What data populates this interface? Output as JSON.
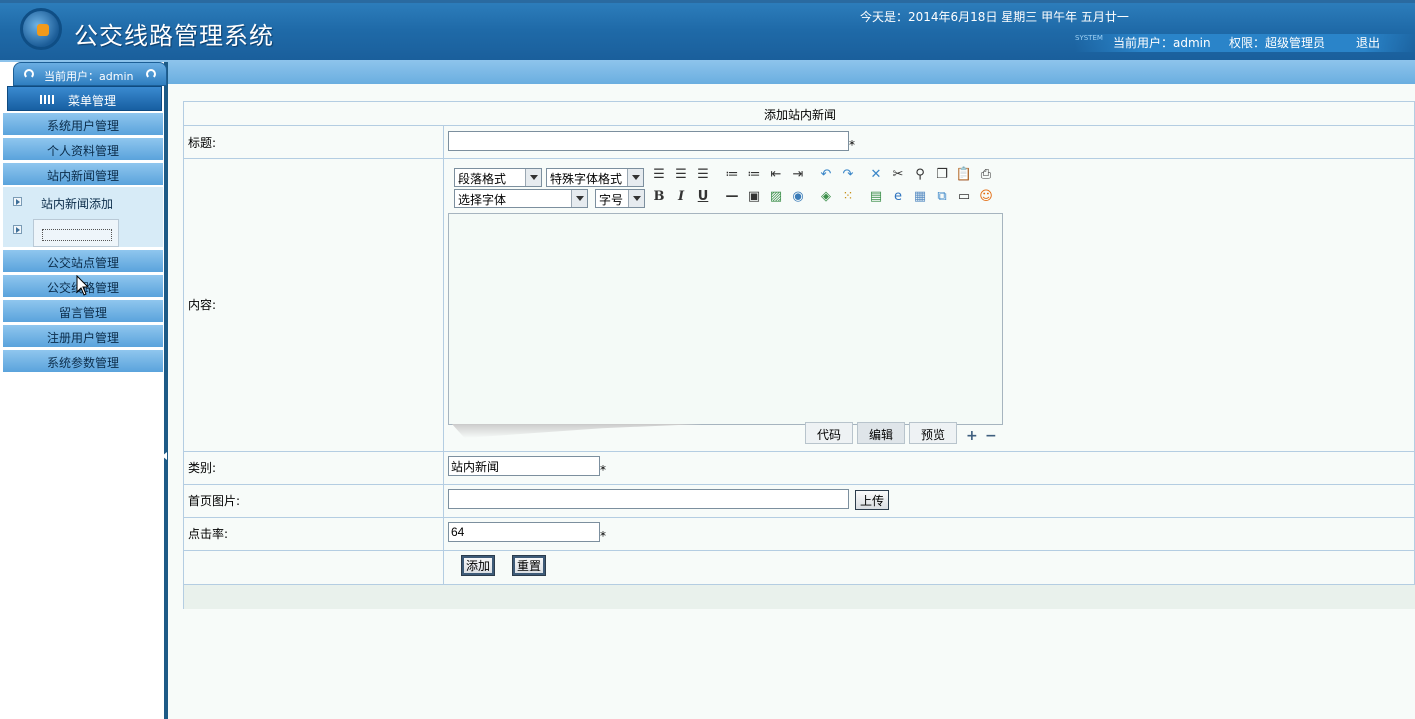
{
  "header": {
    "app_title": "公交线路管理系统",
    "today": "今天是：2014年6月18日 星期三 甲午年 五月廿一",
    "system_tag": "SYSTEM",
    "current_user": "当前用户：admin",
    "permission": "权限：超级管理员",
    "logout": "退出"
  },
  "sidebar": {
    "current_user_tab": "当前用户：admin",
    "menu_header": "菜单管理",
    "items": [
      {
        "label": "系统用户管理"
      },
      {
        "label": "个人资料管理"
      },
      {
        "label": "站内新闻管理"
      },
      {
        "label": "公交站点管理"
      },
      {
        "label": "公交线路管理"
      },
      {
        "label": "留言管理"
      },
      {
        "label": "注册用户管理"
      },
      {
        "label": "系统参数管理"
      }
    ],
    "sub_items": [
      {
        "label": "站内新闻添加"
      },
      {
        "label": ""
      }
    ]
  },
  "form": {
    "heading": "添加站内新闻",
    "title_label": "标题:",
    "title_value": "",
    "required_mark": "*",
    "content_label": "内容:",
    "category_label": "类别:",
    "category_value": "站内新闻",
    "image_label": "首页图片:",
    "image_value": "",
    "upload_button": "上传",
    "clicks_label": "点击率:",
    "clicks_value": "64",
    "add_button": "添加",
    "reset_button": "重置"
  },
  "editor": {
    "paragraph_format": "段落格式",
    "special_format": "特殊字体格式",
    "font_select": "选择字体",
    "font_size": "字号",
    "bold": "B",
    "italic": "I",
    "underline": "U",
    "tabs": [
      {
        "label": "代码"
      },
      {
        "label": "编辑"
      },
      {
        "label": "预览"
      }
    ]
  }
}
